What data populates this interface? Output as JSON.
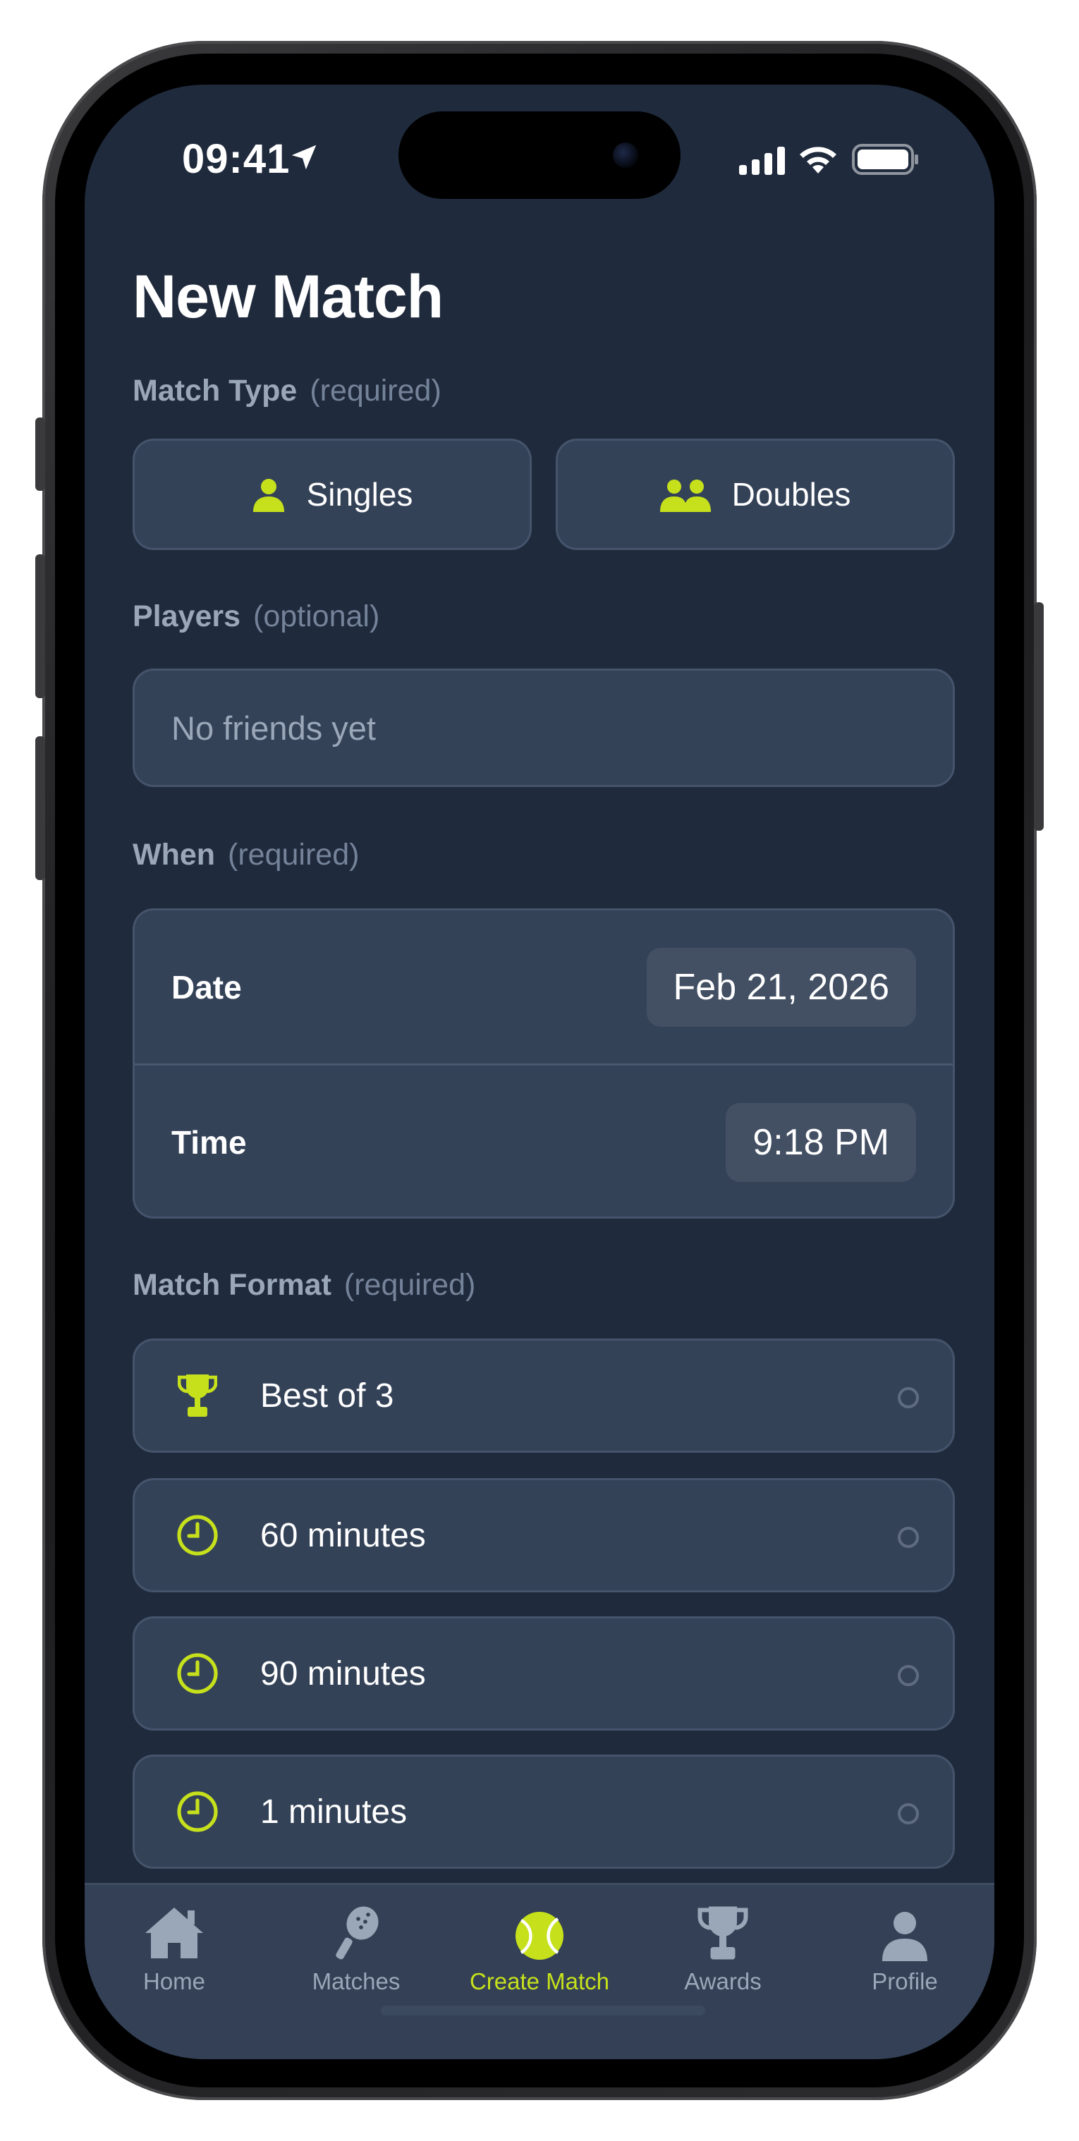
{
  "status_bar": {
    "time": "09:41"
  },
  "screen": {
    "title": "New Match",
    "match_type": {
      "label": "Match Type",
      "hint": "(required)",
      "options": [
        {
          "label": "Singles",
          "icon": "person-icon"
        },
        {
          "label": "Doubles",
          "icon": "people-icon"
        }
      ]
    },
    "players": {
      "label": "Players",
      "hint": "(optional)",
      "placeholder": "No friends yet"
    },
    "when": {
      "label": "When",
      "hint": "(required)",
      "date_label": "Date",
      "date_value": "Feb 21, 2026",
      "time_label": "Time",
      "time_value": "9:18 PM"
    },
    "match_format": {
      "label": "Match Format",
      "hint": "(required)",
      "options": [
        {
          "label": "Best of 3",
          "icon": "trophy-icon",
          "selected": false
        },
        {
          "label": "60 minutes",
          "icon": "clock-icon",
          "selected": false
        },
        {
          "label": "90 minutes",
          "icon": "clock-icon",
          "selected": false
        },
        {
          "label": "1 minutes",
          "icon": "clock-icon",
          "selected": false
        }
      ]
    }
  },
  "tabbar": {
    "items": [
      {
        "label": "Home",
        "icon": "home-icon",
        "active": false
      },
      {
        "label": "Matches",
        "icon": "padel-racket-icon",
        "active": false
      },
      {
        "label": "Create Match",
        "icon": "tennis-ball-icon",
        "active": true
      },
      {
        "label": "Awards",
        "icon": "trophy-icon",
        "active": false
      },
      {
        "label": "Profile",
        "icon": "person-icon",
        "active": false
      }
    ]
  },
  "colors": {
    "background": "#1f2a3c",
    "card": "#344258",
    "accent": "#c6e11c",
    "text_primary": "#ffffff",
    "text_secondary": "#9aa7b8"
  }
}
